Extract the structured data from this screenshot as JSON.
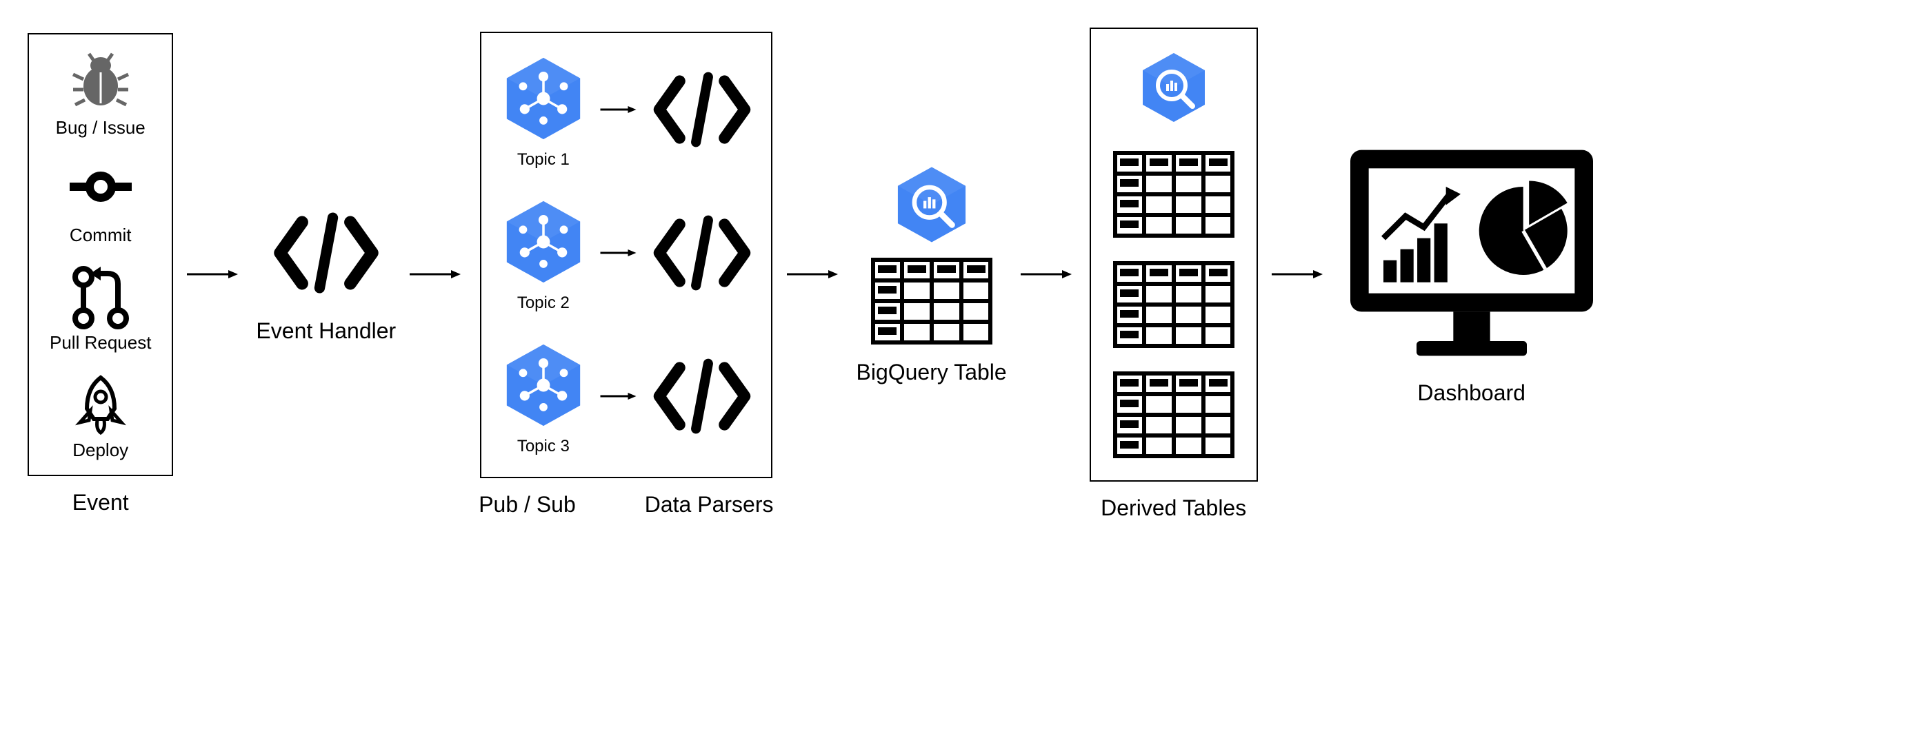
{
  "events": {
    "items": [
      {
        "label": "Bug / Issue",
        "icon": "bug"
      },
      {
        "label": "Commit",
        "icon": "commit"
      },
      {
        "label": "Pull Request",
        "icon": "pull-request"
      },
      {
        "label": "Deploy",
        "icon": "rocket"
      }
    ],
    "label": "Event"
  },
  "handler": {
    "label": "Event Handler"
  },
  "pubsub": {
    "topics": [
      "Topic 1",
      "Topic 2",
      "Topic 3"
    ],
    "left_label": "Pub / Sub",
    "right_label": "Data Parsers"
  },
  "bigquery": {
    "label": "BigQuery Table"
  },
  "derived": {
    "label": "Derived Tables",
    "count": 3
  },
  "dashboard": {
    "label": "Dashboard"
  },
  "colors": {
    "hex": "#4285F4"
  }
}
